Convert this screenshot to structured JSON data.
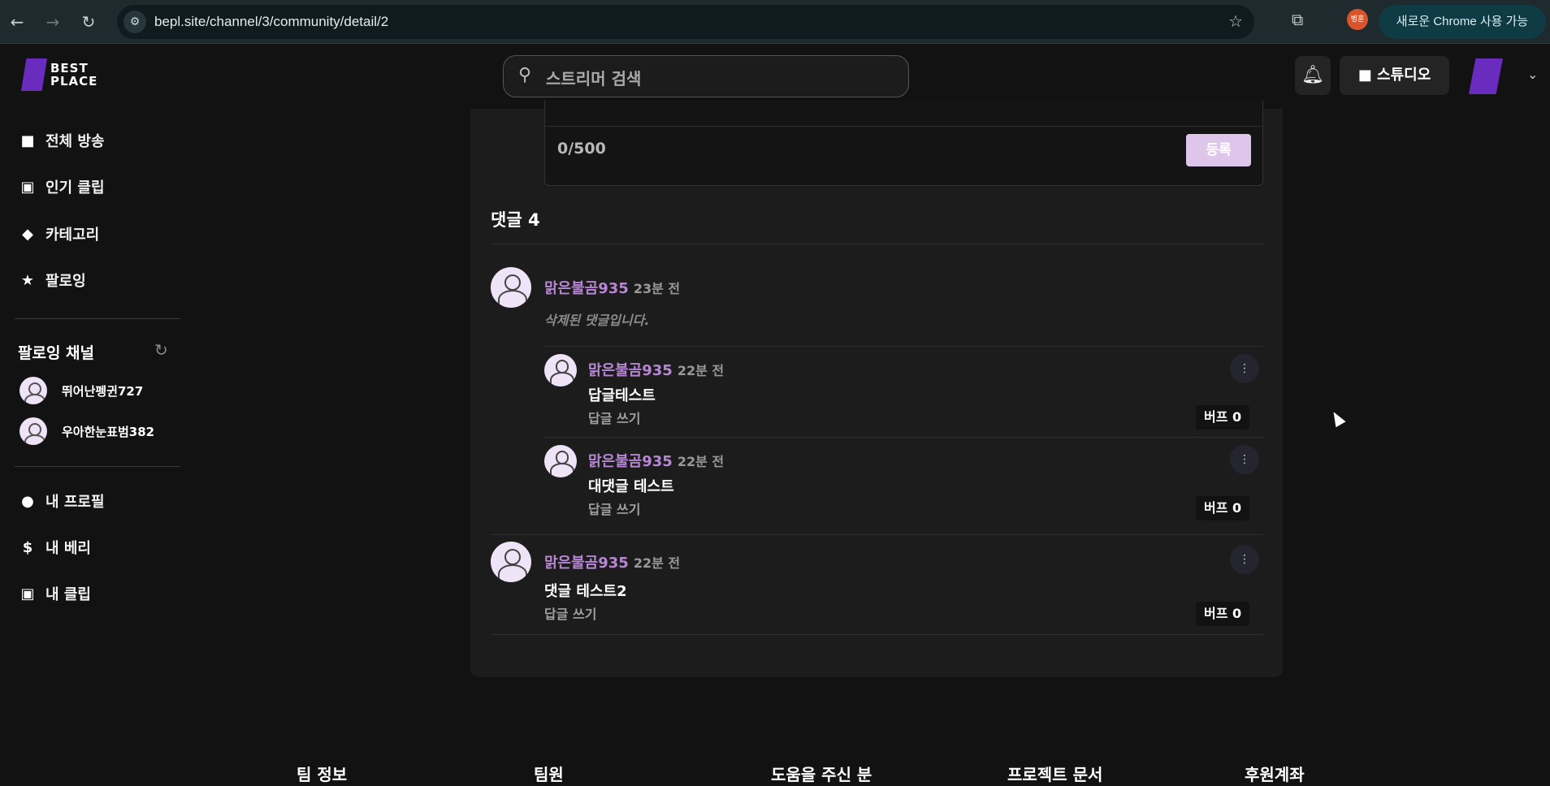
{
  "browser": {
    "url": "bepl.site/channel/3/community/detail/2",
    "profile_badge": "병훈",
    "update_label": "새로운 Chrome 사용 가능"
  },
  "header": {
    "logo_line1": "BEST",
    "logo_line2": "PLACE",
    "search_placeholder": "스트리머 검색",
    "studio_label": "스튜디오"
  },
  "sidebar": {
    "nav": [
      {
        "label": "전체 방송",
        "icon": "video-camera-icon"
      },
      {
        "label": "인기 클립",
        "icon": "clip-icon"
      },
      {
        "label": "카테고리",
        "icon": "tags-icon"
      },
      {
        "label": "팔로잉",
        "icon": "star-icon"
      }
    ],
    "following_title": "팔로잉 채널",
    "channels": [
      {
        "name": "뛰어난펭귄727"
      },
      {
        "name": "우아한눈표범382"
      }
    ],
    "account": [
      {
        "label": "내 프로필",
        "icon": "user-icon"
      },
      {
        "label": "내 베리",
        "icon": "dollar-icon"
      },
      {
        "label": "내 클립",
        "icon": "clip-icon"
      }
    ]
  },
  "composer": {
    "counter": "0/500",
    "submit_label": "등록"
  },
  "comments": {
    "title": "댓글 4",
    "items": [
      {
        "author": "맑은불곰935",
        "time": "23분 전",
        "body": "삭제된 댓글입니다.",
        "deleted": true
      },
      {
        "author": "맑은불곰935",
        "time": "22분 전",
        "body": "답글테스트",
        "reply_label": "답글 쓰기",
        "boost_label": "버프 0"
      },
      {
        "author": "맑은불곰935",
        "time": "22분 전",
        "body": "대댓글 테스트",
        "reply_label": "답글 쓰기",
        "boost_label": "버프 0"
      },
      {
        "author": "맑은불곰935",
        "time": "22분 전",
        "body": "댓글 테스트2",
        "reply_label": "답글 쓰기",
        "boost_label": "버프 0"
      }
    ]
  },
  "footer": {
    "columns": [
      "팀 정보",
      "팀원",
      "도움을 주신 분",
      "프로젝트 문서",
      "후원계좌"
    ]
  }
}
